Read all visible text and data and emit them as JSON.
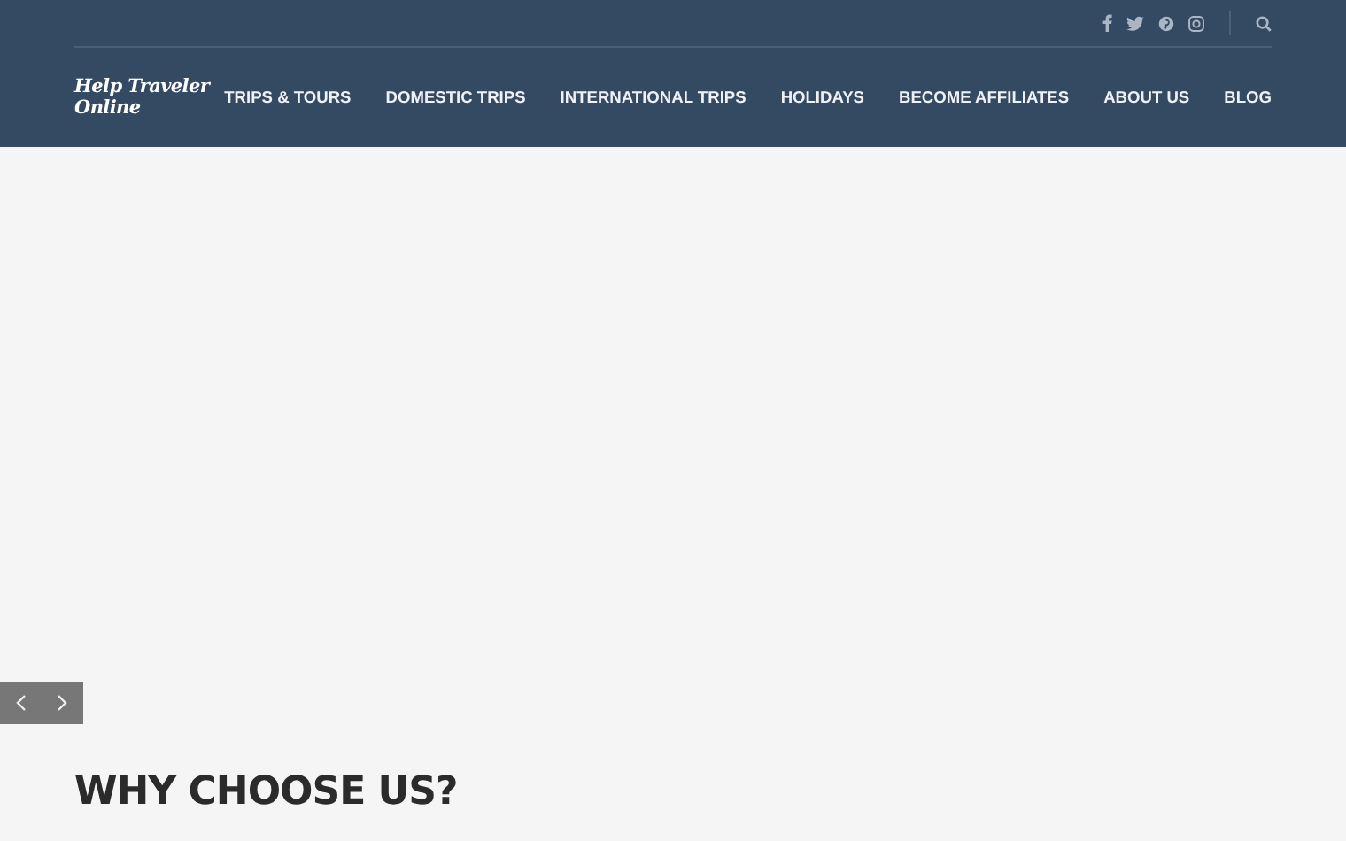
{
  "site": {
    "logo": "Help Traveler Online"
  },
  "nav": [
    {
      "label": "TRIPS & TOURS"
    },
    {
      "label": "DOMESTIC TRIPS"
    },
    {
      "label": "INTERNATIONAL TRIPS"
    },
    {
      "label": "HOLIDAYS"
    },
    {
      "label": "BECOME AFFILIATES"
    },
    {
      "label": "ABOUT US"
    },
    {
      "label": "BLOG"
    }
  ],
  "social": [
    {
      "kind": "facebook"
    },
    {
      "kind": "twitter"
    },
    {
      "kind": "pinterest"
    },
    {
      "kind": "instagram"
    }
  ],
  "section": {
    "heading": "WHY CHOOSE US?"
  }
}
